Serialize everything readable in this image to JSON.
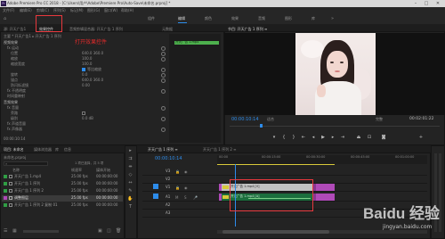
{
  "app": {
    "title": "Adobe Premiere Pro CC 2018 - [C:\\Users\\用户\\Adobe\\Premiere Pro\\Auto-Save\\未命名.prproj] *",
    "menu": [
      "文件(F)",
      "编辑(E)",
      "剪辑(C)",
      "序列(S)",
      "标记(M)",
      "图形(G)",
      "窗口(W)",
      "帮助(H)"
    ]
  },
  "workspaces": [
    "组件",
    "编辑",
    "颜色",
    "效果",
    "音频",
    "图形",
    "库"
  ],
  "left_panel": {
    "tabs": [
      "效果控件",
      "音频剪辑混合器: 开天广告 1 序列",
      "元数据"
    ],
    "annotation": "打开效果控件",
    "source_line": "主要 * 开天广告1 ▸ 开天广告 1 序列",
    "timecode": "00:00:10:14",
    "video_section": "视频效果",
    "rows": [
      {
        "name": "fx 运动",
        "value": ""
      },
      {
        "name": "位置",
        "value": "640.0  360.0"
      },
      {
        "name": "缩放",
        "value": "100.0"
      },
      {
        "name": "缩放宽度",
        "value": "100.0"
      },
      {
        "name": "",
        "value": "等比缩放"
      },
      {
        "name": "旋转",
        "value": "0.0"
      },
      {
        "name": "锚点",
        "value": "640.0  360.0"
      },
      {
        "name": "防闪烁滤镜",
        "value": "0.00"
      },
      {
        "name": "fx 不透明度",
        "value": ""
      },
      {
        "name": "时间重映射",
        "value": ""
      }
    ],
    "audio_section": "音频效果",
    "audio_rows": [
      {
        "name": "fx 音量",
        "value": ""
      },
      {
        "name": "旁路",
        "value": ""
      },
      {
        "name": "级别",
        "value": "0.0 dB"
      },
      {
        "name": "fx 声道音量",
        "value": ""
      },
      {
        "name": "fx 声像器",
        "value": ""
      }
    ],
    "clip_label": "开天广告 1.mp4"
  },
  "program": {
    "title": "节目: 开天广告 1 序列 ≡",
    "timecode_left": "00:00:10:14",
    "fit": "适合",
    "quality": "完整",
    "timecode_right": "00:02:01:22"
  },
  "project_panel": {
    "tabs": [
      "项目: 未命名",
      "媒体浏览器",
      "库",
      "信息"
    ],
    "project_file": "未命名.prproj",
    "count": "1 项已选择，共 5 项",
    "columns": [
      "名称",
      "帧速率",
      "媒体开始"
    ],
    "items": [
      {
        "name": "开天广告 1.mp4",
        "rate": "25.00 fps",
        "start": "00:00:00:00",
        "color": "#2f9e44",
        "selected": false
      },
      {
        "name": "开天广告 1 序列",
        "rate": "25.00 fps",
        "start": "00:00:00:00",
        "color": "#2f9e44",
        "selected": false
      },
      {
        "name": "开天广告 1 序列 2",
        "rate": "25.00 fps",
        "start": "00:00:00:00",
        "color": "#2f9e44",
        "selected": false
      },
      {
        "name": "调整图层",
        "rate": "25.00 fps",
        "start": "00:00:00:00",
        "color": "#b04ab8",
        "selected": true
      },
      {
        "name": "开天广告 1 序列 2 复制 01",
        "rate": "25.00 fps",
        "start": "00:00:00:00",
        "color": "#2f9e44",
        "selected": false
      }
    ]
  },
  "timeline": {
    "tabs": [
      "开天广告 1 序列 ≡",
      "开天广告 1 序列 2 ≡"
    ],
    "timecode": "00:00:10:14",
    "ruler": [
      "00:00",
      "00:00:15:00",
      "00:00:30:00",
      "00:00:45:00",
      "00:01:00:00"
    ],
    "tracks": [
      "V3",
      "V2",
      "V1",
      "A1",
      "A2",
      "A3"
    ],
    "video_clip": "开天广告 1.mp4 [V]",
    "audio_clip": "开天广告 1.mp4 [A]"
  },
  "watermark": {
    "brand": "Baidu 经验",
    "url": "jingyan.baidu.com"
  },
  "colors": {
    "accent": "#2d8ceb",
    "annotation": "#e32b2b",
    "clip_label": "#b04ab8",
    "audio_clip": "#1b6e3d"
  }
}
